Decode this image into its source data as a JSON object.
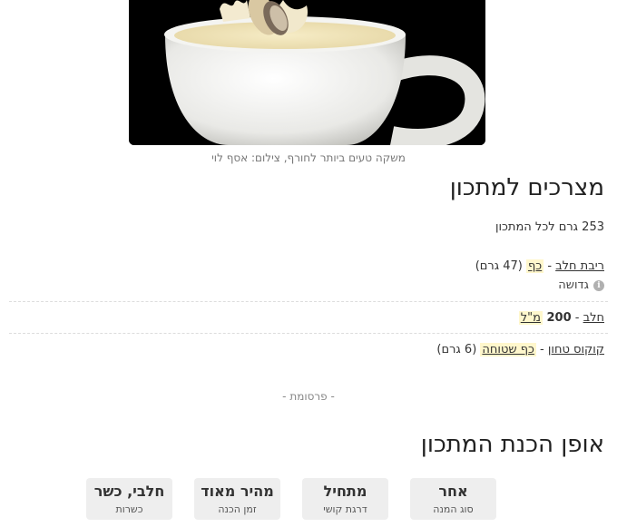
{
  "hero": {
    "caption": "משקה טעים ביותר לחורף, צילום: אסף לוי"
  },
  "ingredients": {
    "heading": "מצרכים למתכון",
    "total": "253 גרם לכל המתכון",
    "items": [
      {
        "name": "ריבת חלב",
        "sep": " - ",
        "amount": "",
        "unit": "כף",
        "note": " (47 גרם)",
        "sub": "גדושה"
      },
      {
        "name": "חלב",
        "sep": " - ",
        "amount": "200 ",
        "unit": "מ\"ל",
        "note": ""
      },
      {
        "name": "קוקוס טחון",
        "sep": " - ",
        "amount": "",
        "unit": "כף שטוחה",
        "note": " (6 גרם)"
      }
    ]
  },
  "ad_label": "- פרסומת -",
  "method": {
    "heading": "אופן הכנת המתכון",
    "info": [
      {
        "value": "אחר",
        "label": "סוג המנה"
      },
      {
        "value": "מתחיל",
        "label": "דרגת קושי"
      },
      {
        "value": "מהיר מאוד",
        "label": "זמן הכנה"
      },
      {
        "value": "חלבי, כשר",
        "label": "כשרות"
      }
    ]
  },
  "icons": {
    "info": "info-icon"
  },
  "colors": {
    "unit_highlight": "#fff7cc",
    "info_box_bg": "#eeeeee"
  }
}
